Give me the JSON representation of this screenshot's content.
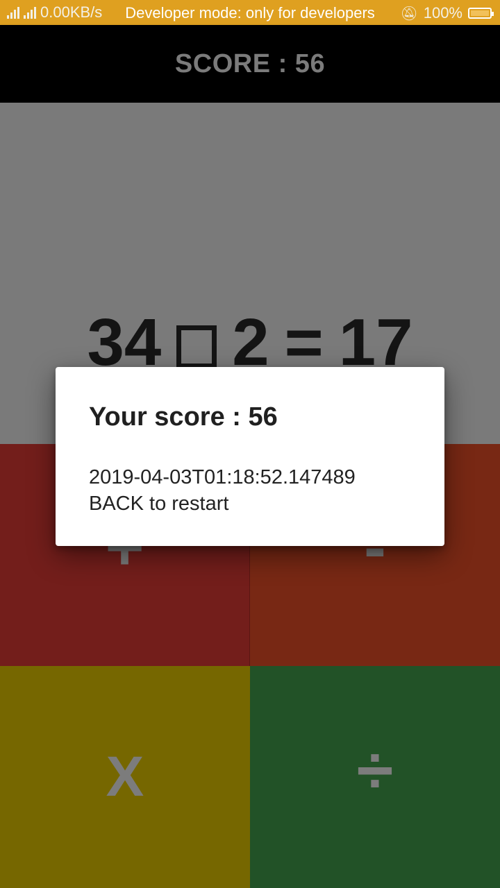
{
  "status_bar": {
    "network_speed": "0.00KB/s",
    "notice": "Developer mode: only for developers",
    "battery": "100%"
  },
  "header": {
    "score_text": "SCORE : 56"
  },
  "equation": {
    "left_operand": "34",
    "right_operand": "2",
    "equals": "=",
    "result": "17"
  },
  "operators": {
    "plus": "+",
    "minus": "-",
    "times": "X",
    "divide": "÷"
  },
  "colors": {
    "plus_bg": "#731e1b",
    "minus_bg": "#782814",
    "times_bg": "#766700",
    "divide_bg": "#225227",
    "status_bar_bg": "#dfa020"
  },
  "dialog": {
    "title": "Your score : 56",
    "timestamp": "2019-04-03T01:18:52.147489",
    "instruction": "BACK to restart"
  }
}
